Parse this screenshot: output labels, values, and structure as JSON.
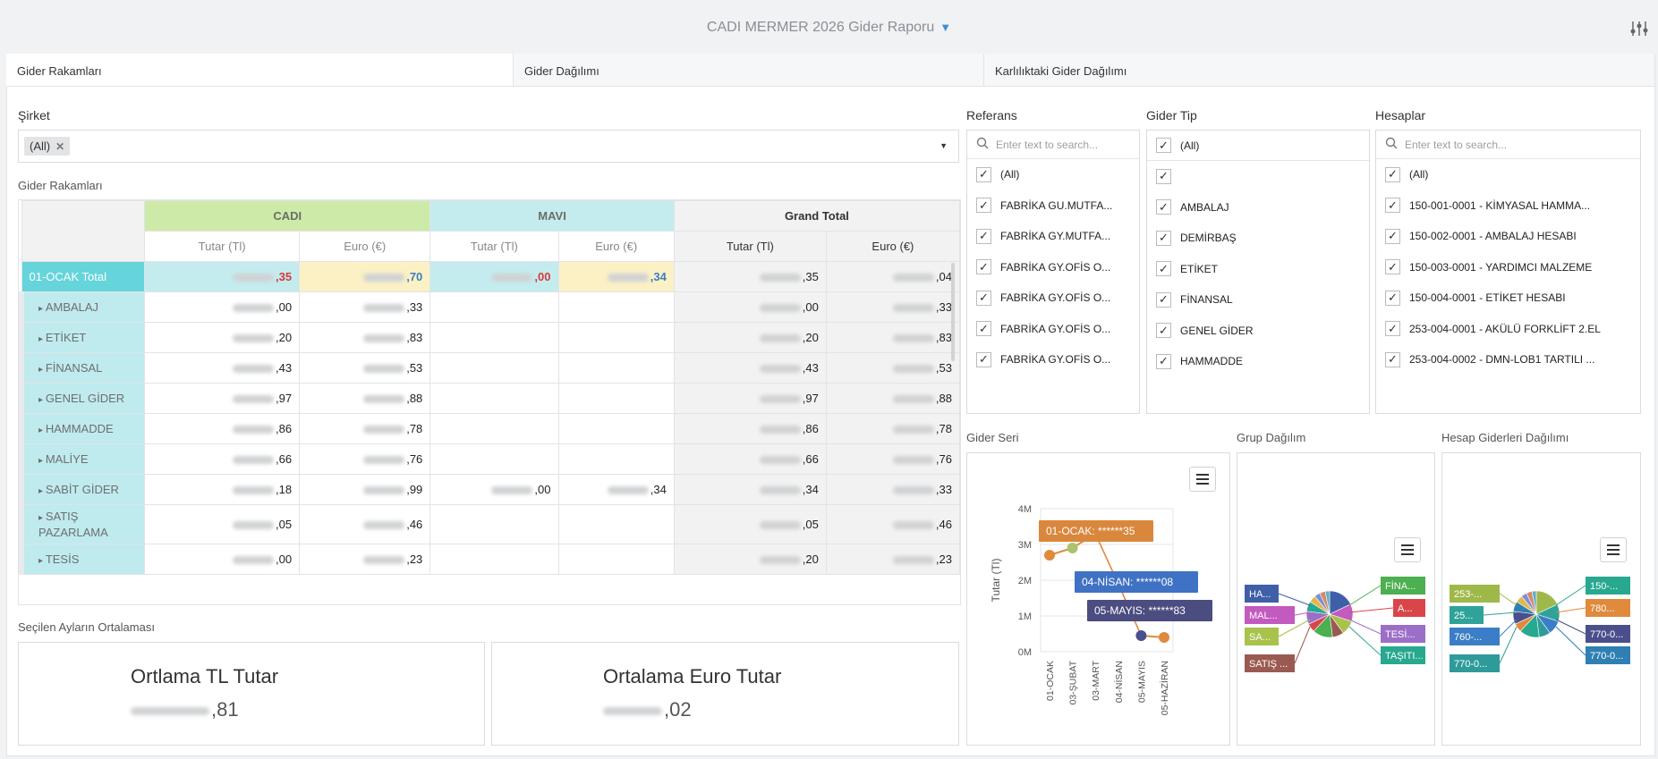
{
  "app": {
    "title": "CADI MERMER 2026 Gider Raporu"
  },
  "tabs": [
    "Gider Rakamları",
    "Gider Dağılımı",
    "Karlılıktaki Gider Dağılımı"
  ],
  "company_filter": {
    "label": "Şirket",
    "chip": "(All)"
  },
  "pivot": {
    "label": "Gider Rakamları",
    "groups": [
      "CADI",
      "MAVI",
      "Grand Total"
    ],
    "subheaders": [
      "Tutar (Tl)",
      "Euro (€)",
      "Tutar (Tl)",
      "Euro (€)",
      "Tutar (Tl)",
      "Euro (€)"
    ],
    "total_row": {
      "label": "01-OCAK Total",
      "cells": [
        ",35",
        ",70",
        ",00",
        ",34",
        ",35",
        ",04"
      ]
    },
    "rows": [
      {
        "label": "AMBALAJ",
        "cells": [
          ",00",
          ",33",
          "",
          "",
          ",00",
          ",33"
        ]
      },
      {
        "label": "ETİKET",
        "cells": [
          ",20",
          ",83",
          "",
          "",
          ",20",
          ",83"
        ]
      },
      {
        "label": "FİNANSAL",
        "cells": [
          ",43",
          ",53",
          "",
          "",
          ",43",
          ",53"
        ]
      },
      {
        "label": "GENEL GİDER",
        "cells": [
          ",97",
          ",88",
          "",
          "",
          ",97",
          ",88"
        ]
      },
      {
        "label": "HAMMADDE",
        "cells": [
          ",86",
          ",78",
          "",
          "",
          ",86",
          ",78"
        ]
      },
      {
        "label": "MALİYE",
        "cells": [
          ",66",
          ",76",
          "",
          "",
          ",66",
          ",76"
        ]
      },
      {
        "label": "SABİT GİDER",
        "cells": [
          ",18",
          ",99",
          ",00",
          ",34",
          ",34",
          ",33"
        ]
      },
      {
        "label": "SATIŞ PAZARLAMA",
        "cells": [
          ",05",
          ",46",
          "",
          "",
          ",05",
          ",46"
        ]
      },
      {
        "label": "TESİS",
        "cells": [
          ",00",
          ",23",
          "",
          "",
          ",20",
          ",23"
        ]
      }
    ]
  },
  "referans": {
    "label": "Referans",
    "placeholder": "Enter text to search...",
    "items": [
      "(All)",
      "FABRİKA GU.MUTFA...",
      "FABRİKA GY.MUTFA...",
      "FABRİKA GY.OFİS O...",
      "FABRİKA GY.OFİS O...",
      "FABRİKA GY.OFİS O...",
      "FABRİKA GY.OFİS O..."
    ]
  },
  "gider_tip": {
    "label": "Gider Tip",
    "items": [
      "(All)",
      "",
      "AMBALAJ",
      "DEMİRBAŞ",
      "ETİKET",
      "FİNANSAL",
      "GENEL GİDER",
      "HAMMADDE"
    ]
  },
  "hesaplar": {
    "label": "Hesaplar",
    "placeholder": "Enter text to search...",
    "items": [
      "(All)",
      "150-001-0001 - KİMYASAL HAMMA...",
      "150-002-0001 - AMBALAJ HESABI",
      "150-003-0001 - YARDIMCI MALZEME",
      "150-004-0001 - ETİKET HESABI",
      "253-004-0001 - AKÜLÜ FORKLİFT 2.EL",
      "253-004-0002 - DMN-LOB1 TARTILI ..."
    ]
  },
  "gider_seri": {
    "label": "Gider Seri",
    "chart_data": {
      "type": "line",
      "ylabel": "Tutar (Tl)",
      "yticks": [
        "0M",
        "1M",
        "2M",
        "3M",
        "4M"
      ],
      "ylim": [
        0,
        4
      ],
      "categories": [
        "01-OCAK",
        "03-ŞUBAT",
        "03-MART",
        "04-NİSAN",
        "05-MAYIS",
        "05-HAZİRAN"
      ],
      "series": [
        {
          "values": [
            2.7,
            2.9,
            3.3
          ],
          "color": "#e08a3c",
          "idx": [
            0,
            1,
            2
          ]
        },
        {
          "values": [
            0.45,
            0.4
          ],
          "color": "#e08a3c",
          "idx": [
            4,
            5
          ]
        }
      ],
      "point_colors": [
        "#e08a3c",
        "#a9c46a",
        "#e08a3c",
        null,
        "#4a4f8c",
        "#e08a3c"
      ],
      "annotations": [
        {
          "text": "01-OCAK: ******35",
          "color": "#d9873d"
        },
        {
          "text": "04-NİSAN: ******08",
          "color": "#3f72c4"
        },
        {
          "text": "05-MAYIS: ******83",
          "color": "#4b4c80"
        }
      ]
    }
  },
  "grup_dagilim": {
    "label": "Grup Dağılım",
    "left_labels": [
      {
        "text": "HA...",
        "color": "#3f5fa8"
      },
      {
        "text": "MAL...",
        "color": "#c35ac0"
      },
      {
        "text": "SA...",
        "color": "#a8c24b"
      },
      {
        "text": "SATIŞ ...",
        "color": "#9a5a52"
      }
    ],
    "right_labels": [
      {
        "text": "FİNA...",
        "color": "#4caf50"
      },
      {
        "text": "A...",
        "color": "#d9464a"
      },
      {
        "text": "TESİ...",
        "color": "#9b6fc7"
      },
      {
        "text": "TAŞITI...",
        "color": "#27a88f"
      }
    ]
  },
  "hesap_dagilim": {
    "label": "Hesap Giderleri Dağılımı",
    "left_labels": [
      {
        "text": "253-...",
        "color": "#9fb84a"
      },
      {
        "text": "25...",
        "color": "#2fa39a"
      },
      {
        "text": "760-...",
        "color": "#3b7ec7"
      },
      {
        "text": "770-0...",
        "color": "#2f9a9a"
      }
    ],
    "right_labels": [
      {
        "text": "150-...",
        "color": "#27a88f"
      },
      {
        "text": "780...",
        "color": "#e08a3c"
      },
      {
        "text": "770-0...",
        "color": "#4a4f8c"
      },
      {
        "text": "770-0...",
        "color": "#2f7fb3"
      }
    ]
  },
  "averages": {
    "label": "Seçilen Ayların Ortalaması",
    "tl": {
      "title": "Ortlama TL Tutar",
      "value": ",81"
    },
    "eur": {
      "title": "Ortalama Euro Tutar",
      "value": ",02"
    }
  }
}
